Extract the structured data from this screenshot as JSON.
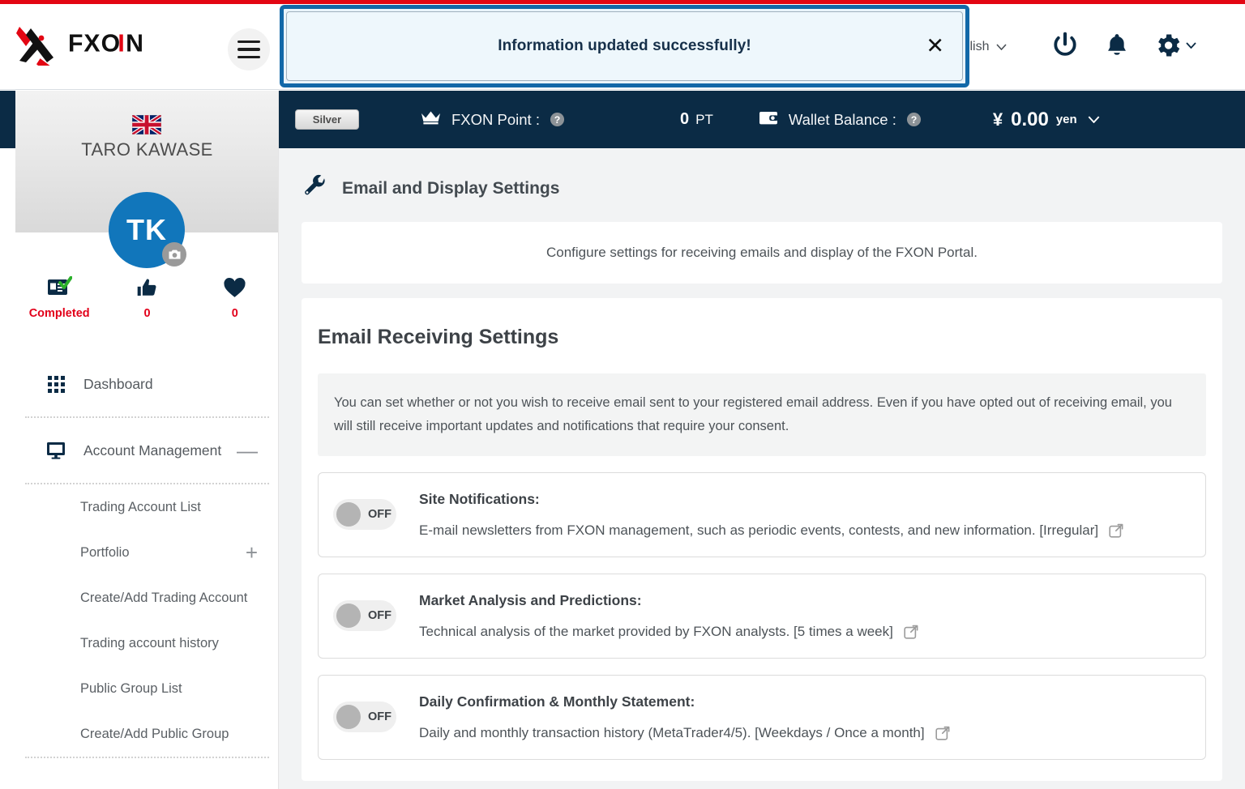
{
  "header": {
    "logo_text": "FXON",
    "menu_icon": "hamburger-menu-icon",
    "language": "English",
    "icons": [
      "power-icon",
      "bell-icon",
      "gear-icon"
    ]
  },
  "toast": {
    "message": "Information updated successfully!",
    "close_label": "✕",
    "border_color": "#1268a8",
    "background": "#eef7fc"
  },
  "sidebar": {
    "flag": "uk-flag-icon",
    "user_name": "TARO KAWASE",
    "avatar_initials": "TK",
    "camera_badge": "camera-icon",
    "stats": [
      {
        "icon": "id-card-verified-icon",
        "label": "Completed"
      },
      {
        "icon": "thumbs-up-icon",
        "label": "0"
      },
      {
        "icon": "heart-icon",
        "label": "0"
      }
    ],
    "nav": [
      {
        "icon": "grid-icon",
        "label": "Dashboard",
        "expander": ""
      },
      {
        "icon": "monitor-icon",
        "label": "Account Management",
        "expander": "—"
      }
    ],
    "sub_items": [
      {
        "label": "Trading Account List",
        "expander": ""
      },
      {
        "label": "Portfolio",
        "expander": "+"
      },
      {
        "label": "Create/Add Trading Account",
        "expander": ""
      },
      {
        "label": "Trading account history",
        "expander": ""
      },
      {
        "label": "Public Group List",
        "expander": ""
      },
      {
        "label": "Create/Add Public Group",
        "expander": ""
      }
    ]
  },
  "statusbar": {
    "tier_badge": "Silver",
    "point_icon": "crown-icon",
    "point_label": "FXON Point :",
    "point_value": "0",
    "point_unit": "PT",
    "wallet_icon": "wallet-icon",
    "wallet_label": "Wallet Balance :",
    "wallet_currency_symbol": "¥",
    "wallet_value": "0.00",
    "wallet_unit": "yen",
    "background": "#0b2b45"
  },
  "main": {
    "page_icon": "wrench-icon",
    "page_title": "Email and Display Settings",
    "intro_text": "Configure settings for receiving emails and display of the FXON Portal.",
    "section_title": "Email Receiving Settings",
    "notice_text": "You can set whether or not you wish to receive email sent to your registered email address. Even if you have opted out of receiving email, you will still receive important updates and notifications that require your consent.",
    "settings": [
      {
        "toggle_state": "OFF",
        "title": "Site Notifications:",
        "description": "E-mail newsletters from FXON management, such as periodic events, contests, and new information. [Irregular]",
        "link_icon": "external-link-icon"
      },
      {
        "toggle_state": "OFF",
        "title": "Market Analysis and Predictions:",
        "description": "Technical analysis of the market provided by FXON analysts. [5 times a week]",
        "link_icon": "external-link-icon"
      },
      {
        "toggle_state": "OFF",
        "title": "Daily Confirmation & Monthly Statement:",
        "description": "Daily and monthly transaction history (MetaTrader4/5). [Weekdays / Once a month]",
        "link_icon": "external-link-icon"
      }
    ]
  },
  "colors": {
    "accent_red": "#e30613",
    "navy": "#0b2b45",
    "avatar_blue": "#1176bb",
    "stat_red": "#e2001a"
  }
}
